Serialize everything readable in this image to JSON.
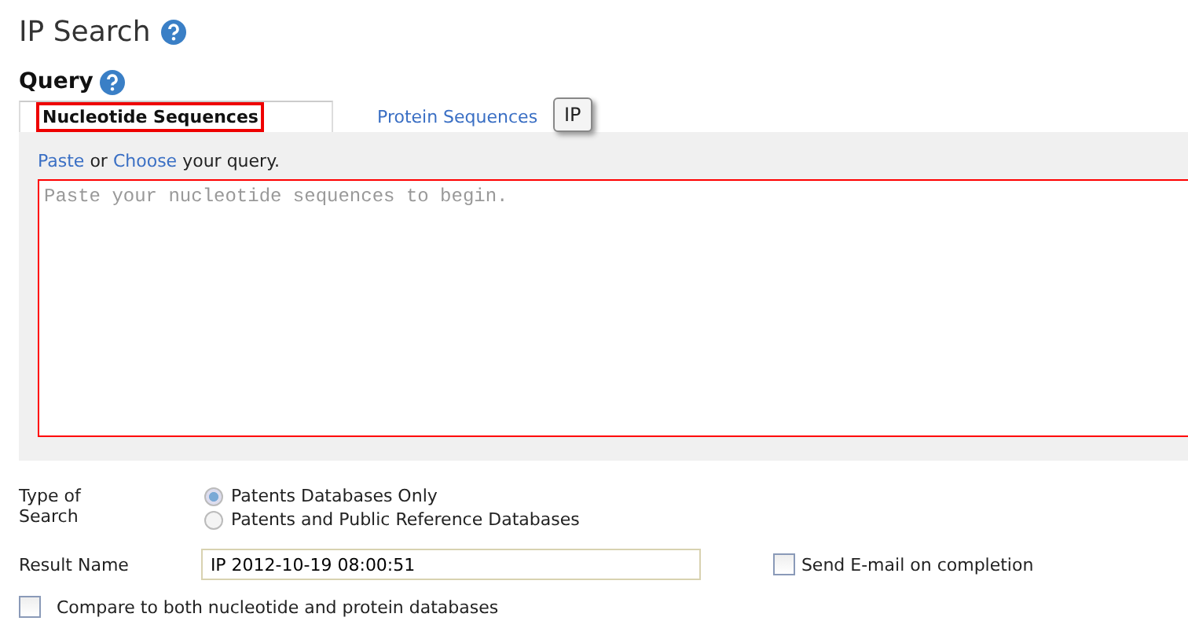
{
  "page_title": "IP Search",
  "query": {
    "heading": "Query",
    "tabs": [
      {
        "label": "Nucleotide Sequences",
        "selected": true
      },
      {
        "label": "Protein Sequences",
        "selected": false
      }
    ],
    "tooltip": "IP",
    "instruction": {
      "paste_link": "Paste",
      "or": "or",
      "choose_link": "Choose",
      "rest": "your query."
    },
    "sequence_field": {
      "placeholder": "Paste your nucleotide sequences to begin."
    }
  },
  "search_type": {
    "label": "Type of Search",
    "options": [
      {
        "label": "Patents Databases Only",
        "selected": true
      },
      {
        "label": "Patents and Public Reference Databases",
        "selected": false
      }
    ]
  },
  "result_name": {
    "label": "Result Name",
    "value": "IP 2012-10-19 08:00:51"
  },
  "send_email": {
    "label": "Send E-mail on completion",
    "checked": false
  },
  "compare_both": {
    "label": "Compare to both nucleotide and protein databases",
    "checked": false
  }
}
